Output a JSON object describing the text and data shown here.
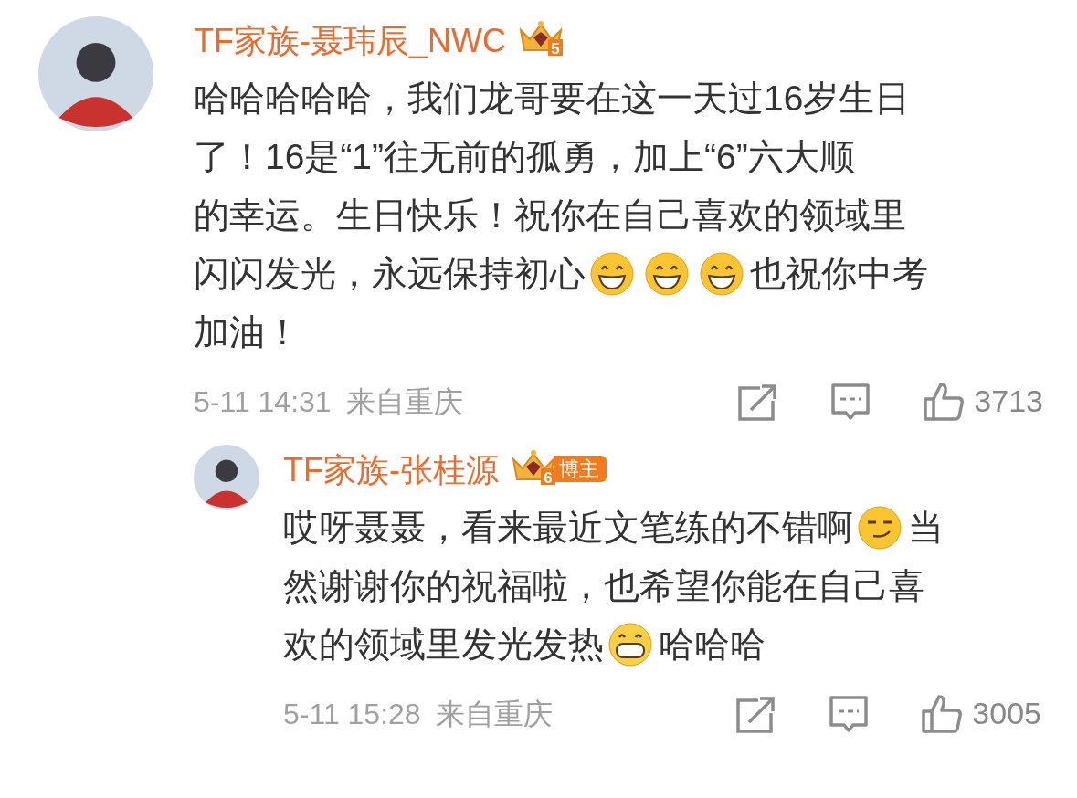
{
  "comments": [
    {
      "user": "TF家族-聂玮辰_NWC",
      "level": "5",
      "lines": [
        [
          {
            "kind": "text",
            "text": "哈哈哈哈哈，我们龙哥要在这一天过16岁生日"
          }
        ],
        [
          {
            "kind": "text",
            "text": "了！16是“1”往无前的孤勇，加上“6”六大顺"
          }
        ],
        [
          {
            "kind": "text",
            "text": "的幸运。生日快乐！祝你在自己喜欢的领域里"
          }
        ],
        [
          {
            "kind": "text",
            "text": "闪闪发光，永远保持初心"
          },
          {
            "kind": "grin"
          },
          {
            "kind": "grin"
          },
          {
            "kind": "grin"
          },
          {
            "kind": "text",
            "text": "也祝你中考"
          }
        ],
        [
          {
            "kind": "text",
            "text": "加油！"
          }
        ]
      ],
      "date": "5-11 14:31",
      "location": "来自重庆",
      "likes": "3713",
      "replies": [
        {
          "user": "TF家族-张桂源",
          "level": "6",
          "role": "博主",
          "lines": [
            [
              {
                "kind": "text",
                "text": "哎呀聂聂，看来最近文笔练的不错啊"
              },
              {
                "kind": "smirk"
              },
              {
                "kind": "text",
                "text": "当"
              }
            ],
            [
              {
                "kind": "text",
                "text": "然谢谢你的祝福啦，也希望你能在自己喜"
              }
            ],
            [
              {
                "kind": "text",
                "text": "欢的领域里发光发热"
              },
              {
                "kind": "teeth"
              },
              {
                "kind": "text",
                "text": "哈哈哈"
              }
            ]
          ],
          "date": "5-11 15:28",
          "location": "来自重庆",
          "likes": "3005"
        }
      ]
    }
  ]
}
